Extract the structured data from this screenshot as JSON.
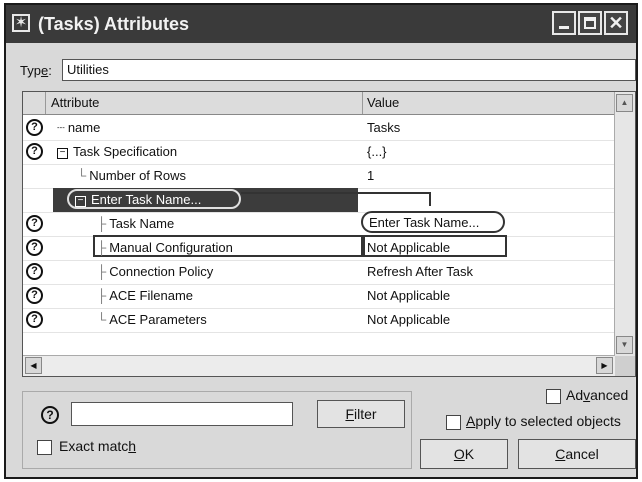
{
  "window": {
    "title": "(Tasks) Attributes",
    "icon": "star-icon",
    "controls": [
      "minimize-icon",
      "maximize-icon",
      "close-icon"
    ]
  },
  "type_field": {
    "label_pre": "Typ",
    "label_accel": "e",
    "label_post": ":",
    "value": "Utilities"
  },
  "table": {
    "headers": {
      "attribute": "Attribute",
      "value": "Value"
    },
    "rows": [
      {
        "help": "?",
        "tree": "┄",
        "attribute": "name",
        "value": "Tasks"
      },
      {
        "help": "?",
        "expander": "−",
        "attribute": "Task Specification",
        "value": "{...}"
      },
      {
        "tree": "└",
        "attribute": "Number of Rows",
        "value": "1"
      },
      {
        "expander": "−",
        "attribute": "Enter Task Name...",
        "value": ""
      },
      {
        "help": "?",
        "tree": "├",
        "attribute": "Task Name",
        "value": "Enter Task Name..."
      },
      {
        "help": "?",
        "tree": "├",
        "attribute": "Manual Configuration",
        "value": "Not Applicable"
      },
      {
        "help": "?",
        "tree": "├",
        "attribute": "Connection Policy",
        "value": "Refresh After Task"
      },
      {
        "help": "?",
        "tree": "├",
        "attribute": "ACE Filename",
        "value": "Not Applicable"
      },
      {
        "help": "?",
        "tree": "└",
        "attribute": "ACE Parameters",
        "value": "Not Applicable"
      }
    ]
  },
  "filter": {
    "help": "?",
    "input_value": "",
    "button_pre": "",
    "button_accel": "F",
    "button_post": "ilter",
    "exact_match_pre": "Exact matc",
    "exact_match_accel": "h",
    "exact_match_post": ""
  },
  "options": {
    "advanced_pre": "Ad",
    "advanced_accel": "v",
    "advanced_post": "anced",
    "apply_pre": "",
    "apply_accel": "A",
    "apply_post": "pply to selected objects"
  },
  "buttons": {
    "ok_pre": "",
    "ok_accel": "O",
    "ok_post": "K",
    "cancel_pre": "",
    "cancel_accel": "C",
    "cancel_post": "ancel"
  }
}
